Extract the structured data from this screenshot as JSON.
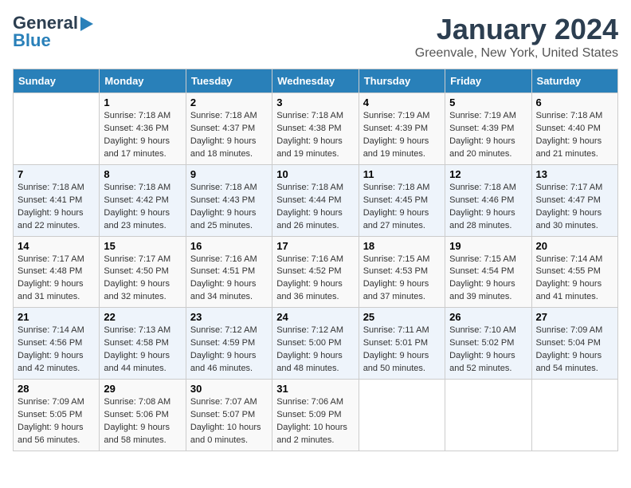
{
  "logo": {
    "line1": "General",
    "line2": "Blue"
  },
  "title": "January 2024",
  "subtitle": "Greenvale, New York, United States",
  "weekdays": [
    "Sunday",
    "Monday",
    "Tuesday",
    "Wednesday",
    "Thursday",
    "Friday",
    "Saturday"
  ],
  "weeks": [
    [
      {
        "day": "",
        "info": ""
      },
      {
        "day": "1",
        "info": "Sunrise: 7:18 AM\nSunset: 4:36 PM\nDaylight: 9 hours\nand 17 minutes."
      },
      {
        "day": "2",
        "info": "Sunrise: 7:18 AM\nSunset: 4:37 PM\nDaylight: 9 hours\nand 18 minutes."
      },
      {
        "day": "3",
        "info": "Sunrise: 7:18 AM\nSunset: 4:38 PM\nDaylight: 9 hours\nand 19 minutes."
      },
      {
        "day": "4",
        "info": "Sunrise: 7:19 AM\nSunset: 4:39 PM\nDaylight: 9 hours\nand 19 minutes."
      },
      {
        "day": "5",
        "info": "Sunrise: 7:19 AM\nSunset: 4:39 PM\nDaylight: 9 hours\nand 20 minutes."
      },
      {
        "day": "6",
        "info": "Sunrise: 7:18 AM\nSunset: 4:40 PM\nDaylight: 9 hours\nand 21 minutes."
      }
    ],
    [
      {
        "day": "7",
        "info": "Sunrise: 7:18 AM\nSunset: 4:41 PM\nDaylight: 9 hours\nand 22 minutes."
      },
      {
        "day": "8",
        "info": "Sunrise: 7:18 AM\nSunset: 4:42 PM\nDaylight: 9 hours\nand 23 minutes."
      },
      {
        "day": "9",
        "info": "Sunrise: 7:18 AM\nSunset: 4:43 PM\nDaylight: 9 hours\nand 25 minutes."
      },
      {
        "day": "10",
        "info": "Sunrise: 7:18 AM\nSunset: 4:44 PM\nDaylight: 9 hours\nand 26 minutes."
      },
      {
        "day": "11",
        "info": "Sunrise: 7:18 AM\nSunset: 4:45 PM\nDaylight: 9 hours\nand 27 minutes."
      },
      {
        "day": "12",
        "info": "Sunrise: 7:18 AM\nSunset: 4:46 PM\nDaylight: 9 hours\nand 28 minutes."
      },
      {
        "day": "13",
        "info": "Sunrise: 7:17 AM\nSunset: 4:47 PM\nDaylight: 9 hours\nand 30 minutes."
      }
    ],
    [
      {
        "day": "14",
        "info": "Sunrise: 7:17 AM\nSunset: 4:48 PM\nDaylight: 9 hours\nand 31 minutes."
      },
      {
        "day": "15",
        "info": "Sunrise: 7:17 AM\nSunset: 4:50 PM\nDaylight: 9 hours\nand 32 minutes."
      },
      {
        "day": "16",
        "info": "Sunrise: 7:16 AM\nSunset: 4:51 PM\nDaylight: 9 hours\nand 34 minutes."
      },
      {
        "day": "17",
        "info": "Sunrise: 7:16 AM\nSunset: 4:52 PM\nDaylight: 9 hours\nand 36 minutes."
      },
      {
        "day": "18",
        "info": "Sunrise: 7:15 AM\nSunset: 4:53 PM\nDaylight: 9 hours\nand 37 minutes."
      },
      {
        "day": "19",
        "info": "Sunrise: 7:15 AM\nSunset: 4:54 PM\nDaylight: 9 hours\nand 39 minutes."
      },
      {
        "day": "20",
        "info": "Sunrise: 7:14 AM\nSunset: 4:55 PM\nDaylight: 9 hours\nand 41 minutes."
      }
    ],
    [
      {
        "day": "21",
        "info": "Sunrise: 7:14 AM\nSunset: 4:56 PM\nDaylight: 9 hours\nand 42 minutes."
      },
      {
        "day": "22",
        "info": "Sunrise: 7:13 AM\nSunset: 4:58 PM\nDaylight: 9 hours\nand 44 minutes."
      },
      {
        "day": "23",
        "info": "Sunrise: 7:12 AM\nSunset: 4:59 PM\nDaylight: 9 hours\nand 46 minutes."
      },
      {
        "day": "24",
        "info": "Sunrise: 7:12 AM\nSunset: 5:00 PM\nDaylight: 9 hours\nand 48 minutes."
      },
      {
        "day": "25",
        "info": "Sunrise: 7:11 AM\nSunset: 5:01 PM\nDaylight: 9 hours\nand 50 minutes."
      },
      {
        "day": "26",
        "info": "Sunrise: 7:10 AM\nSunset: 5:02 PM\nDaylight: 9 hours\nand 52 minutes."
      },
      {
        "day": "27",
        "info": "Sunrise: 7:09 AM\nSunset: 5:04 PM\nDaylight: 9 hours\nand 54 minutes."
      }
    ],
    [
      {
        "day": "28",
        "info": "Sunrise: 7:09 AM\nSunset: 5:05 PM\nDaylight: 9 hours\nand 56 minutes."
      },
      {
        "day": "29",
        "info": "Sunrise: 7:08 AM\nSunset: 5:06 PM\nDaylight: 9 hours\nand 58 minutes."
      },
      {
        "day": "30",
        "info": "Sunrise: 7:07 AM\nSunset: 5:07 PM\nDaylight: 10 hours\nand 0 minutes."
      },
      {
        "day": "31",
        "info": "Sunrise: 7:06 AM\nSunset: 5:09 PM\nDaylight: 10 hours\nand 2 minutes."
      },
      {
        "day": "",
        "info": ""
      },
      {
        "day": "",
        "info": ""
      },
      {
        "day": "",
        "info": ""
      }
    ]
  ]
}
